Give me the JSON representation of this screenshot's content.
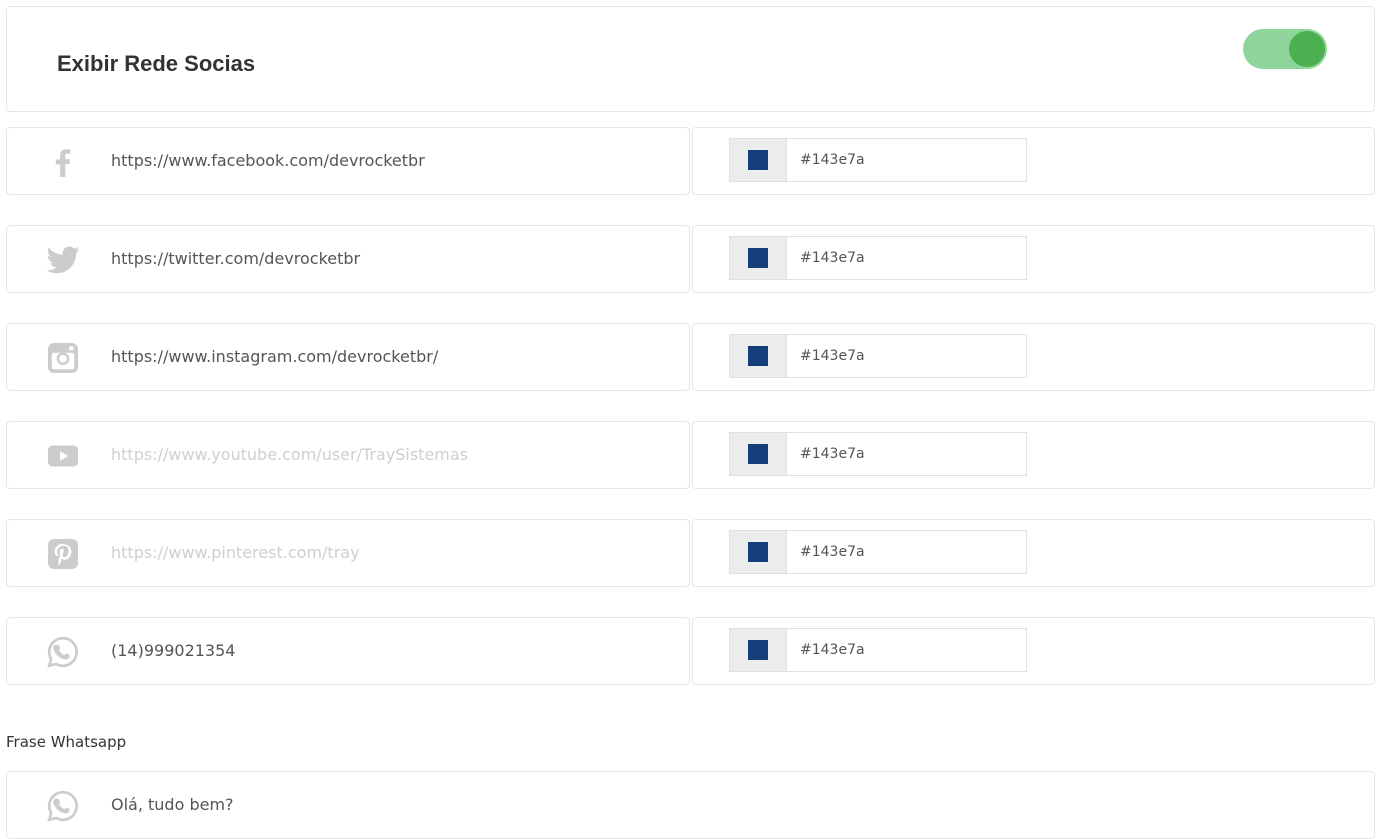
{
  "header": {
    "title": "Exibir Rede Socias",
    "toggle_on": true
  },
  "rows": [
    {
      "icon": "facebook-icon",
      "url": "https://www.facebook.com/devrocketbr",
      "placeholder": false,
      "color_value": "#143e7a",
      "swatch_color": "#143e7a"
    },
    {
      "icon": "twitter-icon",
      "url": "https://twitter.com/devrocketbr",
      "placeholder": false,
      "color_value": "#143e7a",
      "swatch_color": "#143e7a"
    },
    {
      "icon": "instagram-icon",
      "url": "https://www.instagram.com/devrocketbr/",
      "placeholder": false,
      "color_value": "#143e7a",
      "swatch_color": "#143e7a"
    },
    {
      "icon": "youtube-icon",
      "url": "https://www.youtube.com/user/TraySistemas",
      "placeholder": true,
      "color_value": "#143e7a",
      "swatch_color": "#143e7a"
    },
    {
      "icon": "pinterest-icon",
      "url": "https://www.pinterest.com/tray",
      "placeholder": true,
      "color_value": "#143e7a",
      "swatch_color": "#143e7a"
    },
    {
      "icon": "whatsapp-icon",
      "url": "(14)999021354",
      "placeholder": false,
      "color_value": "#143e7a",
      "swatch_color": "#143e7a"
    }
  ],
  "whatsapp_phrase": {
    "label": "Frase Whatsapp",
    "icon": "whatsapp-icon",
    "value": "Olá, tudo bem?"
  },
  "colors": {
    "icon_gray": "#cccccc",
    "toggle_track": "#8fd49a",
    "toggle_knob": "#4caf50"
  }
}
